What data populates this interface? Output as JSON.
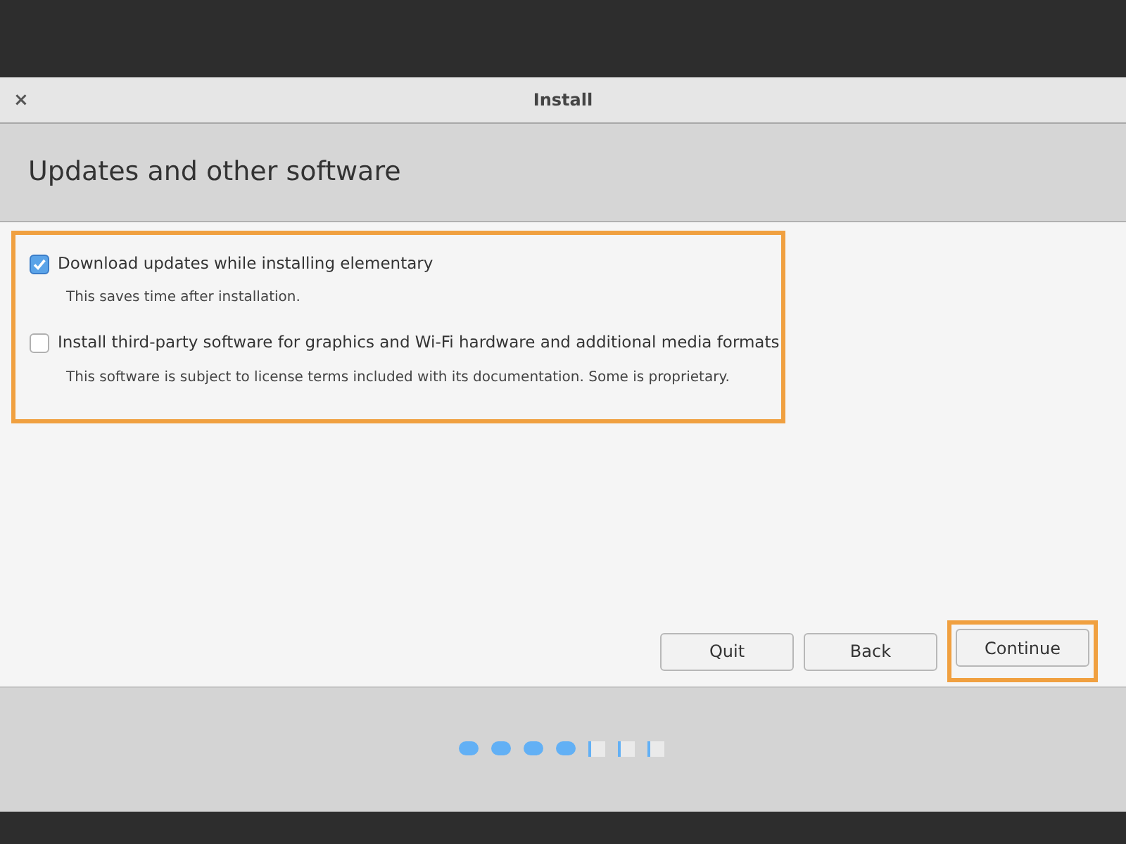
{
  "window": {
    "title": "Install",
    "close": "×"
  },
  "header": {
    "title": "Updates and other software"
  },
  "options": [
    {
      "label": "Download updates while installing elementary",
      "description": "This saves time after installation.",
      "checked": true
    },
    {
      "label": "Install third-party software for graphics and Wi-Fi hardware and additional media formats",
      "description": "This software is subject to license terms included with its documentation. Some is proprietary.",
      "checked": false
    }
  ],
  "buttons": [
    {
      "label": "Quit",
      "highlighted": false
    },
    {
      "label": "Back",
      "highlighted": false
    },
    {
      "label": "Continue",
      "highlighted": true
    }
  ],
  "progress": [
    {
      "done": true
    },
    {
      "done": true
    },
    {
      "done": true
    },
    {
      "done": true
    },
    {
      "done": false
    },
    {
      "done": false
    },
    {
      "done": false
    }
  ]
}
